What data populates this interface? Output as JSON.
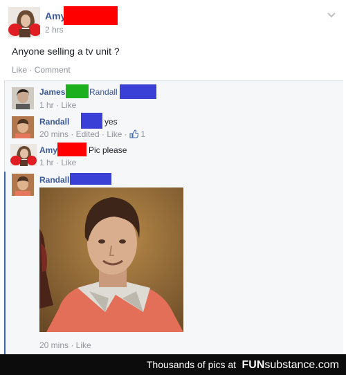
{
  "post": {
    "author": "Amy",
    "time": "2 hrs",
    "text": "Anyone selling a tv unit ?",
    "actions": {
      "like": "Like",
      "sep": "·",
      "comment": "Comment"
    },
    "menu_icon": "chevron-down-icon"
  },
  "comments": [
    {
      "author": "James",
      "mention": "Randall",
      "text": "",
      "meta": "1 hr · Like"
    },
    {
      "author": "Randall",
      "text": "yes",
      "meta": "20 mins · Edited · Like ·",
      "likes": "1"
    },
    {
      "author": "Amy",
      "text": "Pic please",
      "meta": "1 hr · Like"
    },
    {
      "author": "Randall",
      "text": "",
      "meta": "20 mins · Like"
    }
  ],
  "footer": {
    "text": "Thousands of pics at",
    "logo_fun": "FUN",
    "logo_rest": "substance.com"
  },
  "colors": {
    "name": "#3b5998",
    "redact_red": "#ff0000",
    "redact_green": "#1db01d",
    "redact_blue": "#3a3fd6",
    "footer_bg": "#0c0c0c"
  }
}
